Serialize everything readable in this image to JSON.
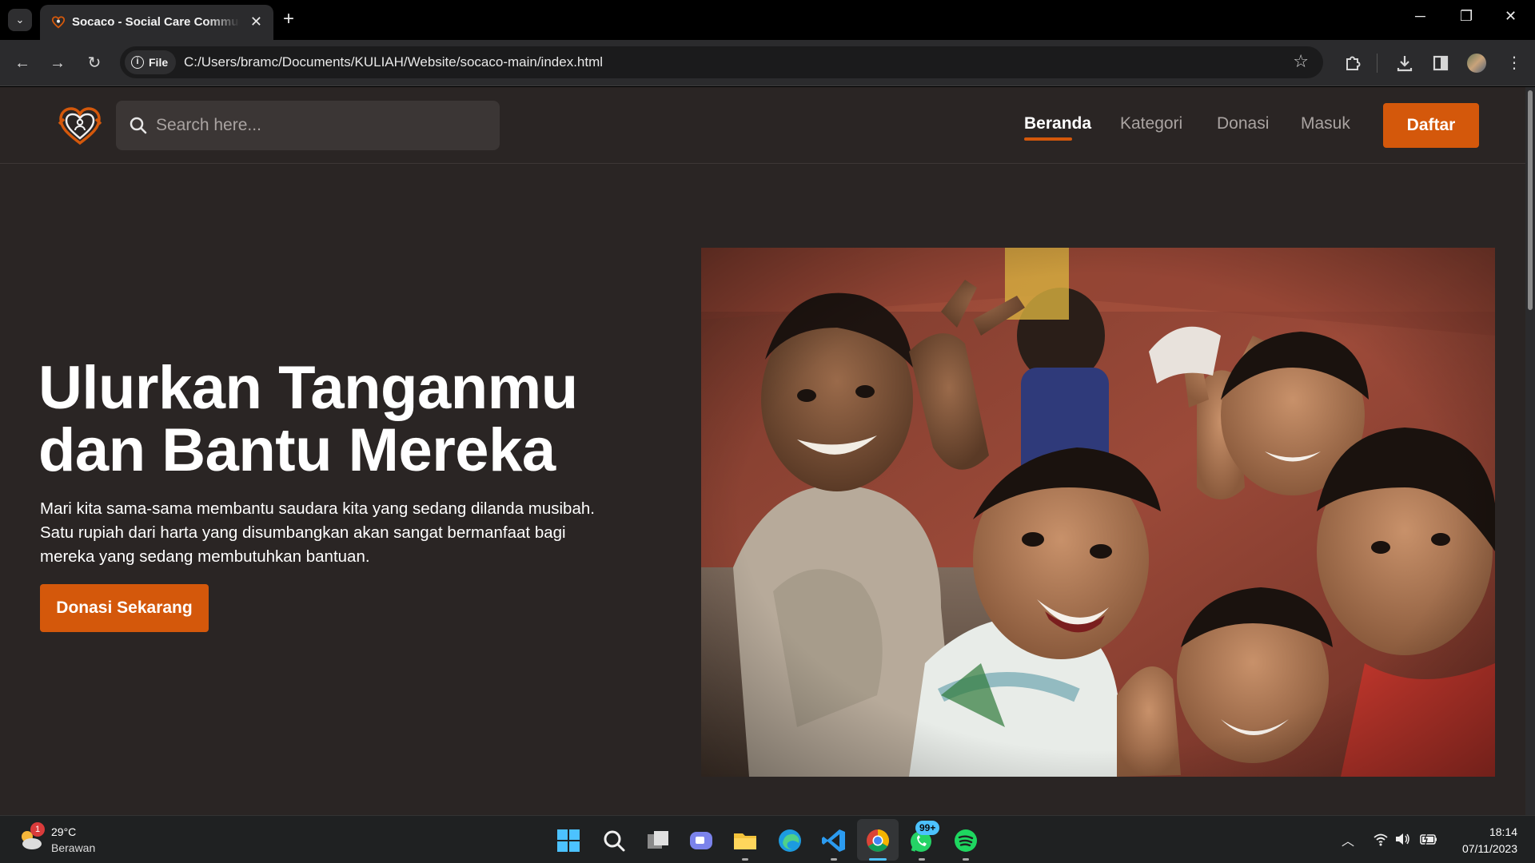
{
  "browser": {
    "tab_title": "Socaco - Social Care Community",
    "tab_close": "✕",
    "new_tab": "+",
    "file_chip": "File",
    "url": "C:/Users/bramc/Documents/KULIAH/Website/socaco-main/index.html"
  },
  "site": {
    "search_placeholder": "Search here...",
    "nav": [
      {
        "label": "Beranda",
        "active": true
      },
      {
        "label": "Kategori",
        "active": false
      },
      {
        "label": "Donasi",
        "active": false
      },
      {
        "label": "Masuk",
        "active": false
      }
    ],
    "daftar_label": "Daftar",
    "accent": "#d4580b",
    "background": "#2a2524"
  },
  "hero": {
    "title_lines": [
      "Ulurkan Tanganmu",
      "dan Bantu Mereka"
    ],
    "description_lines": [
      "Mari kita sama-sama membantu saudara kita yang sedang dilanda musibah.",
      "Satu rupiah dari harta yang disumbangkan akan sangat bermanfaat bagi",
      "mereka yang sedang membutuhkan bantuan."
    ],
    "cta_label": "Donasi Sekarang"
  },
  "taskbar": {
    "weather_temp": "29°C",
    "weather_cond": "Berawan",
    "weather_badge": "1",
    "whatsapp_badge": "99+",
    "time": "18:14",
    "date": "07/11/2023"
  }
}
